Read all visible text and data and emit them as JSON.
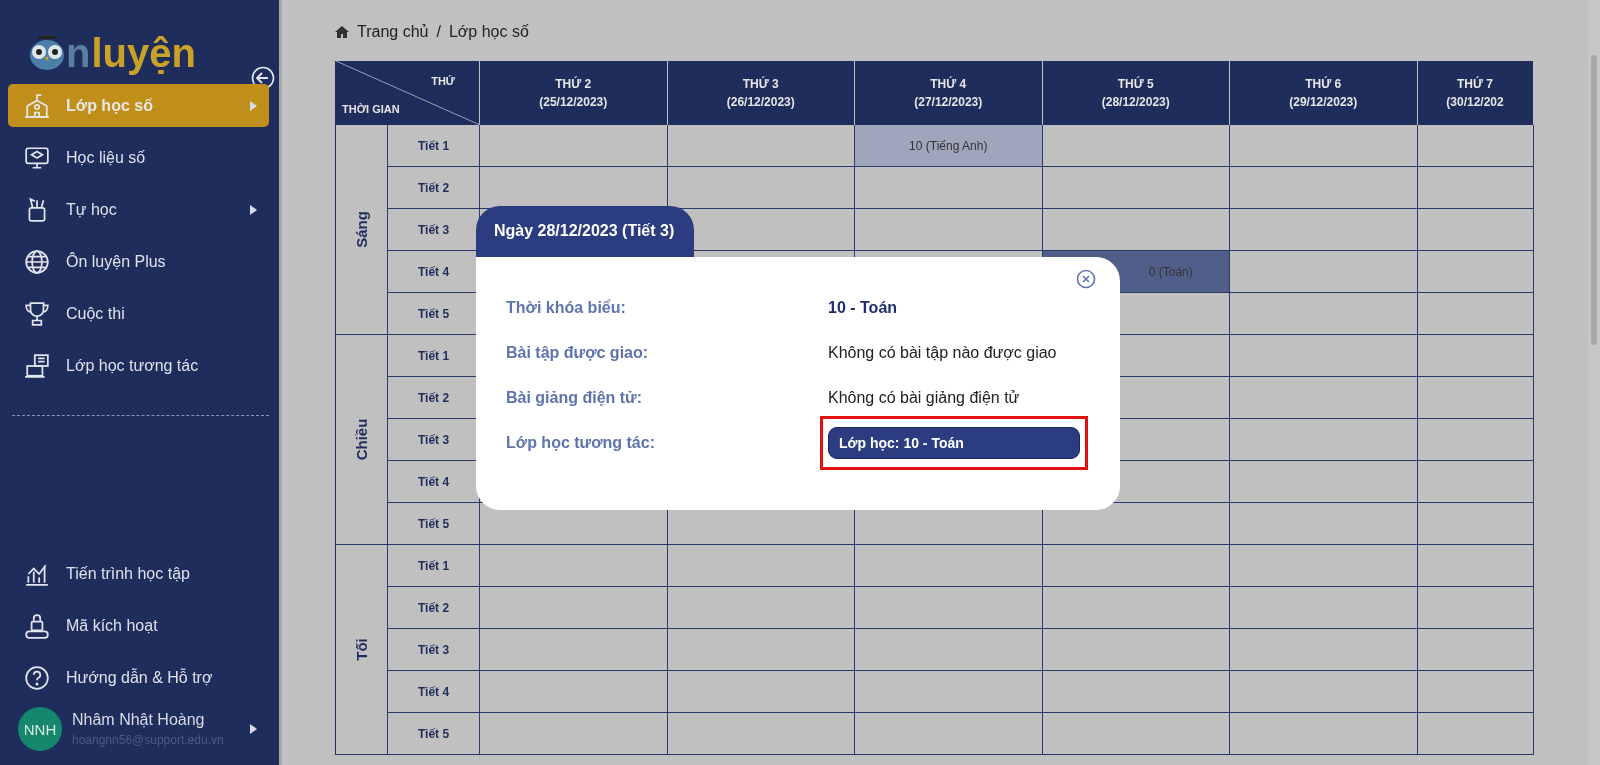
{
  "sidebar": {
    "logo": {
      "parts": [
        "n",
        "luyện"
      ]
    },
    "items": [
      {
        "label": "Lớp học số",
        "selected": true,
        "submenu": true
      },
      {
        "label": "Học liệu số",
        "selected": false,
        "submenu": false
      },
      {
        "label": "Tự học",
        "selected": false,
        "submenu": true
      },
      {
        "label": "Ôn luyện Plus",
        "selected": false,
        "submenu": false
      },
      {
        "label": "Cuộc thi",
        "selected": false,
        "submenu": false
      },
      {
        "label": "Lớp học tương tác",
        "selected": false,
        "submenu": false
      }
    ],
    "bottom_items": [
      {
        "label": "Tiến trình học tập"
      },
      {
        "label": "Mã kích hoạt"
      },
      {
        "label": "Hướng dẫn & Hỗ trợ"
      }
    ],
    "user": {
      "initials": "NNH",
      "name": "Nhâm Nhật Hoàng",
      "email": "hoangnn56@support.edu.vn"
    }
  },
  "breadcrumb": [
    "Trang chủ",
    "/",
    "Lớp học số"
  ],
  "timetable": {
    "corner": {
      "top": "THỨ",
      "bottom": "THỜI GIAN"
    },
    "days": [
      {
        "name": "THỨ 2",
        "date": "(25/12/2023)"
      },
      {
        "name": "THỨ 3",
        "date": "(26/12/2023)"
      },
      {
        "name": "THỨ 4",
        "date": "(27/12/2023)"
      },
      {
        "name": "THỨ 5",
        "date": "(28/12/2023)"
      },
      {
        "name": "THỨ 6",
        "date": "(29/12/2023)"
      },
      {
        "name": "THỨ 7",
        "date": "(30/12/202"
      }
    ],
    "sessions": [
      {
        "name": "Sáng",
        "periods": [
          {
            "label": "Tiết 1",
            "cells": [
              {
                "kind": "empty"
              },
              {
                "kind": "empty"
              },
              {
                "kind": "lesson",
                "text": "10 (Tiếng Anh)",
                "selected": false
              },
              {
                "kind": "empty"
              },
              {
                "kind": "empty"
              },
              {
                "kind": "empty"
              }
            ]
          },
          {
            "label": "Tiết 2",
            "cells": [
              {
                "kind": "empty"
              },
              {
                "kind": "empty"
              },
              {
                "kind": "empty"
              },
              {
                "kind": "empty"
              },
              {
                "kind": "empty"
              },
              {
                "kind": "empty"
              }
            ]
          },
          {
            "label": "Tiết 3",
            "cells": [
              {
                "kind": "empty"
              },
              {
                "kind": "empty"
              },
              {
                "kind": "empty"
              },
              {
                "kind": "empty"
              },
              {
                "kind": "empty"
              },
              {
                "kind": "empty"
              }
            ]
          },
          {
            "label": "Tiết 4",
            "cells": [
              {
                "kind": "empty"
              },
              {
                "kind": "empty"
              },
              {
                "kind": "empty"
              },
              {
                "kind": "lesson",
                "text": "0 (Toán)",
                "selected": true
              },
              {
                "kind": "empty"
              },
              {
                "kind": "empty"
              }
            ]
          },
          {
            "label": "Tiết 5",
            "cells": [
              {
                "kind": "empty"
              },
              {
                "kind": "empty"
              },
              {
                "kind": "empty"
              },
              {
                "kind": "empty"
              },
              {
                "kind": "empty"
              },
              {
                "kind": "empty"
              }
            ]
          }
        ]
      },
      {
        "name": "Chiều",
        "periods": [
          {
            "label": "Tiết 1",
            "cells": [
              {
                "kind": "empty"
              },
              {
                "kind": "empty"
              },
              {
                "kind": "empty"
              },
              {
                "kind": "empty"
              },
              {
                "kind": "empty"
              },
              {
                "kind": "empty"
              }
            ]
          },
          {
            "label": "Tiết 2",
            "cells": [
              {
                "kind": "empty"
              },
              {
                "kind": "empty"
              },
              {
                "kind": "empty"
              },
              {
                "kind": "empty"
              },
              {
                "kind": "empty"
              },
              {
                "kind": "empty"
              }
            ]
          },
          {
            "label": "Tiết 3",
            "cells": [
              {
                "kind": "empty"
              },
              {
                "kind": "empty"
              },
              {
                "kind": "empty"
              },
              {
                "kind": "empty"
              },
              {
                "kind": "empty"
              },
              {
                "kind": "empty"
              }
            ]
          },
          {
            "label": "Tiết 4",
            "cells": [
              {
                "kind": "empty"
              },
              {
                "kind": "empty"
              },
              {
                "kind": "empty"
              },
              {
                "kind": "empty"
              },
              {
                "kind": "empty"
              },
              {
                "kind": "empty"
              }
            ]
          },
          {
            "label": "Tiết 5",
            "cells": [
              {
                "kind": "empty"
              },
              {
                "kind": "empty"
              },
              {
                "kind": "empty"
              },
              {
                "kind": "empty"
              },
              {
                "kind": "empty"
              },
              {
                "kind": "empty"
              }
            ]
          }
        ]
      },
      {
        "name": "Tối",
        "periods": [
          {
            "label": "Tiết 1",
            "cells": [
              {
                "kind": "empty"
              },
              {
                "kind": "empty"
              },
              {
                "kind": "empty"
              },
              {
                "kind": "empty"
              },
              {
                "kind": "empty"
              },
              {
                "kind": "empty"
              }
            ]
          },
          {
            "label": "Tiết 2",
            "cells": [
              {
                "kind": "empty"
              },
              {
                "kind": "empty"
              },
              {
                "kind": "empty"
              },
              {
                "kind": "empty"
              },
              {
                "kind": "empty"
              },
              {
                "kind": "empty"
              }
            ]
          },
          {
            "label": "Tiết 3",
            "cells": [
              {
                "kind": "empty"
              },
              {
                "kind": "empty"
              },
              {
                "kind": "empty"
              },
              {
                "kind": "empty"
              },
              {
                "kind": "empty"
              },
              {
                "kind": "empty"
              }
            ]
          },
          {
            "label": "Tiết 4",
            "cells": [
              {
                "kind": "empty"
              },
              {
                "kind": "empty"
              },
              {
                "kind": "empty"
              },
              {
                "kind": "empty"
              },
              {
                "kind": "empty"
              },
              {
                "kind": "empty"
              }
            ]
          },
          {
            "label": "Tiết 5",
            "cells": [
              {
                "kind": "empty"
              },
              {
                "kind": "empty"
              },
              {
                "kind": "empty"
              },
              {
                "kind": "empty"
              },
              {
                "kind": "empty"
              },
              {
                "kind": "empty"
              }
            ]
          }
        ]
      }
    ]
  },
  "modal": {
    "title": "Ngày 28/12/2023 (Tiết 3)",
    "rows": [
      {
        "label": "Thời khóa biểu:",
        "kind": "bold",
        "value": "10 - Toán"
      },
      {
        "label": "Bài tập được giao:",
        "kind": "plain",
        "value": "Không có bài tập nào được giao"
      },
      {
        "label": "Bài giảng điện tử:",
        "kind": "plain",
        "value": "Không có bài giảng điện tử"
      },
      {
        "label": "Lớp học tương tác:",
        "kind": "button",
        "value": "Lớp học: 10 - Toán",
        "highlighted": true
      }
    ]
  }
}
